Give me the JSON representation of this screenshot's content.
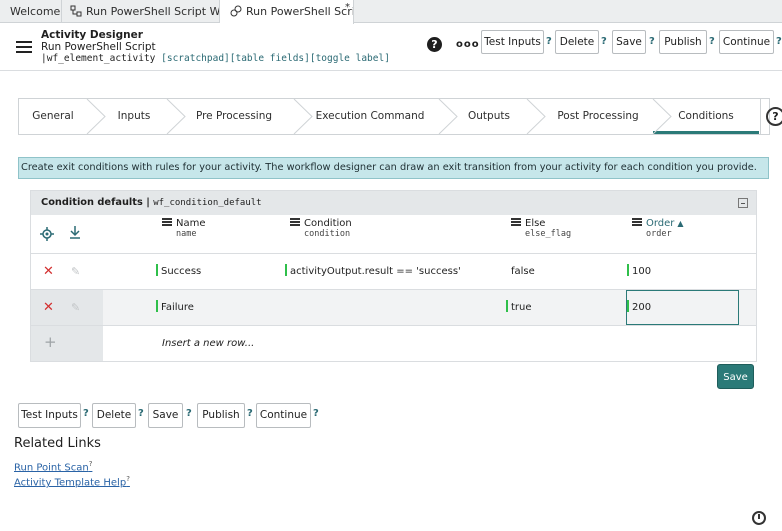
{
  "tabs": [
    {
      "label": "Welcome",
      "icon": "none"
    },
    {
      "label": "Run PowerShell Script Wor...",
      "icon": "workflow-icon"
    },
    {
      "label": "Run PowerShell Script",
      "icon": "gear-link-icon",
      "modified": "*"
    }
  ],
  "header": {
    "title": "Activity Designer",
    "subtitle": "Run PowerShell Script",
    "table_name": "wf_element_activity",
    "annotations": "[scratchpad][table fields][toggle label]",
    "help_glyph": "?",
    "more_glyph": "ooo",
    "buttons": {
      "test_inputs": "Test Inputs",
      "delete": "Delete",
      "save": "Save",
      "publish": "Publish",
      "continue": "Continue",
      "hint": "?"
    }
  },
  "steps": [
    "General",
    "Inputs",
    "Pre Processing",
    "Execution Command",
    "Outputs",
    "Post Processing",
    "Conditions"
  ],
  "active_step": "Conditions",
  "help_glyph": "?",
  "info_message": "Create exit conditions with rules for your activity. The workflow designer can draw an exit transition from your activity for each condition you provide.",
  "panel": {
    "title": "Condition defaults",
    "table_name": "wf_condition_default",
    "columns": [
      {
        "label": "Name",
        "field": "name"
      },
      {
        "label": "Condition",
        "field": "condition"
      },
      {
        "label": "Else",
        "field": "else_flag"
      },
      {
        "label": "Order",
        "field": "order",
        "sort": "▲"
      }
    ],
    "rows": [
      {
        "name": "Success",
        "condition": "activityOutput.result == 'success'",
        "else": "false",
        "order": "100"
      },
      {
        "name": "Failure",
        "condition": "",
        "else": "true",
        "order": "200"
      }
    ],
    "insert_row": "Insert a new row...",
    "save": "Save"
  },
  "bottom_buttons": {
    "test_inputs": "Test Inputs",
    "delete": "Delete",
    "save": "Save",
    "publish": "Publish",
    "continue": "Continue",
    "hint": "?"
  },
  "related_links": {
    "title": "Related Links",
    "items": [
      "Run Point Scan",
      "Activity Template Help"
    ],
    "sup": "?"
  },
  "colors": {
    "accent": "#2b7a78",
    "info_bg": "#c6e6ea",
    "delete_red": "#d32f2f",
    "marker_green": "#2fbf4a"
  }
}
